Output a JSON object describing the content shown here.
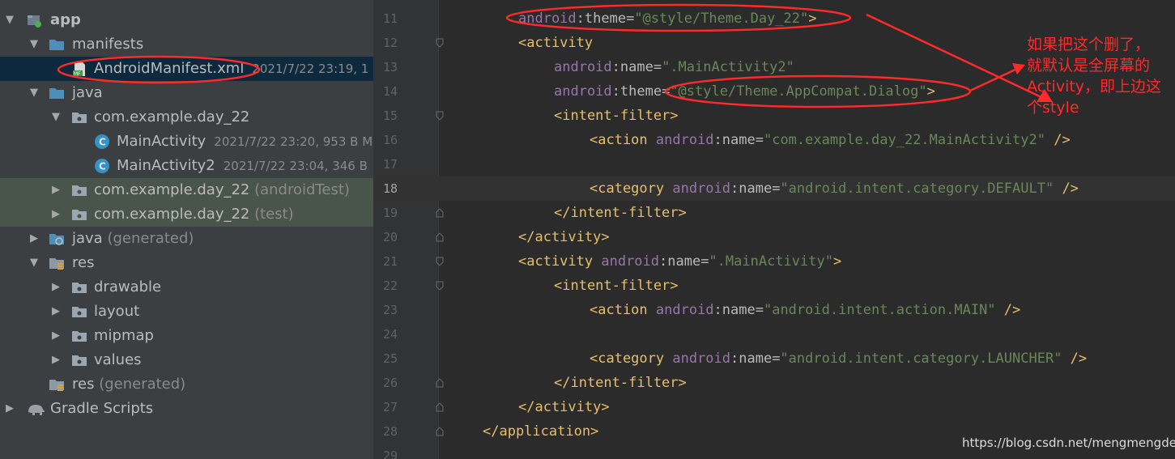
{
  "tree": {
    "items": [
      {
        "label": "app",
        "meta": "",
        "suffix": ""
      },
      {
        "label": "manifests",
        "meta": "",
        "suffix": ""
      },
      {
        "label": "AndroidManifest.xml",
        "meta": "2021/7/22 23:19, 1",
        "suffix": ""
      },
      {
        "label": "java",
        "meta": "",
        "suffix": ""
      },
      {
        "label": "com.example.day_22",
        "meta": "",
        "suffix": ""
      },
      {
        "label": "MainActivity",
        "meta": "2021/7/22 23:20, 953 B M",
        "suffix": ""
      },
      {
        "label": "MainActivity2",
        "meta": "2021/7/22 23:04, 346 B",
        "suffix": ""
      },
      {
        "label": "com.example.day_22",
        "meta": "",
        "suffix": " (androidTest)"
      },
      {
        "label": "com.example.day_22",
        "meta": "",
        "suffix": " (test)"
      },
      {
        "label": "java",
        "meta": "",
        "suffix": " (generated)"
      },
      {
        "label": "res",
        "meta": "",
        "suffix": ""
      },
      {
        "label": "drawable",
        "meta": "",
        "suffix": ""
      },
      {
        "label": "layout",
        "meta": "",
        "suffix": ""
      },
      {
        "label": "mipmap",
        "meta": "",
        "suffix": ""
      },
      {
        "label": "values",
        "meta": "",
        "suffix": ""
      },
      {
        "label": "res",
        "meta": "",
        "suffix": " (generated)"
      },
      {
        "label": "Gradle Scripts",
        "meta": "",
        "suffix": ""
      }
    ]
  },
  "editor": {
    "current_line": "18",
    "lines": [
      {
        "num": "11",
        "tokens": [
          {
            "t": "ns",
            "v": "android"
          },
          {
            "t": "attr",
            "v": ":theme="
          },
          {
            "t": "val",
            "v": "\"@style/Theme.Day_22\""
          },
          {
            "t": "tag",
            "v": ">"
          }
        ]
      },
      {
        "num": "12",
        "tokens": [
          {
            "t": "tag",
            "v": "<activity"
          }
        ]
      },
      {
        "num": "13",
        "tokens": [
          {
            "t": "ns",
            "v": "android"
          },
          {
            "t": "attr",
            "v": ":name="
          },
          {
            "t": "val",
            "v": "\".MainActivity2\""
          }
        ]
      },
      {
        "num": "14",
        "tokens": [
          {
            "t": "ns",
            "v": "android"
          },
          {
            "t": "attr",
            "v": ":theme="
          },
          {
            "t": "val",
            "v": "\"@style/Theme.AppCompat.Dialog\""
          },
          {
            "t": "tag",
            "v": ">"
          }
        ]
      },
      {
        "num": "15",
        "tokens": [
          {
            "t": "tag",
            "v": "<intent-filter>"
          }
        ]
      },
      {
        "num": "16",
        "tokens": [
          {
            "t": "tag",
            "v": "<action "
          },
          {
            "t": "ns",
            "v": "android"
          },
          {
            "t": "attr",
            "v": ":name="
          },
          {
            "t": "val",
            "v": "\"com.example.day_22.MainActivity2\""
          },
          {
            "t": "tag",
            "v": " />"
          }
        ]
      },
      {
        "num": "17",
        "tokens": []
      },
      {
        "num": "18",
        "tokens": [
          {
            "t": "tag",
            "v": "<category "
          },
          {
            "t": "ns",
            "v": "android"
          },
          {
            "t": "attr",
            "v": ":name="
          },
          {
            "t": "val",
            "v": "\"android.intent.category.DEFAULT\""
          },
          {
            "t": "tag",
            "v": " />"
          }
        ]
      },
      {
        "num": "19",
        "tokens": [
          {
            "t": "tag",
            "v": "</intent-filter>"
          }
        ]
      },
      {
        "num": "20",
        "tokens": [
          {
            "t": "tag",
            "v": "</activity>"
          }
        ]
      },
      {
        "num": "21",
        "tokens": [
          {
            "t": "tag",
            "v": "<activity "
          },
          {
            "t": "ns",
            "v": "android"
          },
          {
            "t": "attr",
            "v": ":name="
          },
          {
            "t": "val",
            "v": "\".MainActivity\""
          },
          {
            "t": "tag",
            "v": ">"
          }
        ]
      },
      {
        "num": "22",
        "tokens": [
          {
            "t": "tag",
            "v": "<intent-filter>"
          }
        ]
      },
      {
        "num": "23",
        "tokens": [
          {
            "t": "tag",
            "v": "<action "
          },
          {
            "t": "ns",
            "v": "android"
          },
          {
            "t": "attr",
            "v": ":name="
          },
          {
            "t": "val",
            "v": "\"android.intent.action.MAIN\""
          },
          {
            "t": "tag",
            "v": " />"
          }
        ]
      },
      {
        "num": "24",
        "tokens": []
      },
      {
        "num": "25",
        "tokens": [
          {
            "t": "tag",
            "v": "<category "
          },
          {
            "t": "ns",
            "v": "android"
          },
          {
            "t": "attr",
            "v": ":name="
          },
          {
            "t": "val",
            "v": "\"android.intent.category.LAUNCHER\""
          },
          {
            "t": "tag",
            "v": " />"
          }
        ]
      },
      {
        "num": "26",
        "tokens": [
          {
            "t": "tag",
            "v": "</intent-filter>"
          }
        ]
      },
      {
        "num": "27",
        "tokens": [
          {
            "t": "tag",
            "v": "</activity>"
          }
        ]
      },
      {
        "num": "28",
        "tokens": [
          {
            "t": "tag",
            "v": "</application>"
          }
        ]
      },
      {
        "num": "29",
        "tokens": []
      }
    ]
  },
  "annotation": {
    "note_lines": [
      "如果把这个删了，",
      "就默认是全屏幕的",
      "Activity，即上边这",
      "个style"
    ],
    "color": "#ff2a2a"
  },
  "watermark": "https://blog.csdn.net/mengmengde_",
  "colors": {
    "tree_bg": "#3c3f41",
    "editor_bg": "#2b2b2b",
    "tag": "#e8bf6a",
    "namespace": "#9876aa",
    "value": "#6a8759",
    "selection": "#0d293e"
  }
}
